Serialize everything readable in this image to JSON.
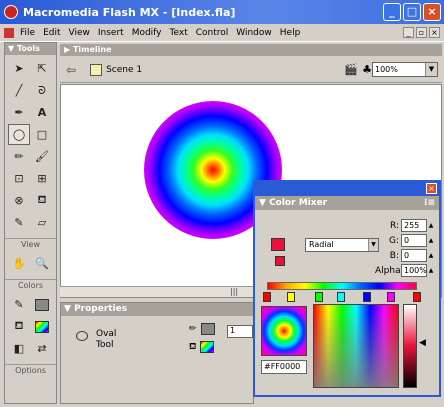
{
  "window": {
    "title": "Macromedia Flash MX - [Index.fla]"
  },
  "menu": [
    "File",
    "Edit",
    "View",
    "Insert",
    "Modify",
    "Text",
    "Control",
    "Window",
    "Help"
  ],
  "tools_panel": {
    "title": "Tools",
    "sections": {
      "view": "View",
      "colors": "Colors",
      "options": "Options"
    }
  },
  "timeline": {
    "title": "Timeline",
    "scene": "Scene 1",
    "zoom": "100%"
  },
  "properties": {
    "title": "Properties",
    "tool_line1": "Oval",
    "tool_line2": "Tool",
    "field": "1"
  },
  "color_mixer": {
    "title": "Color Mixer",
    "type": "Radial",
    "r_label": "R:",
    "g_label": "G:",
    "b_label": "B:",
    "alpha_label": "Alpha:",
    "r": "255",
    "g": "0",
    "b": "0",
    "alpha": "100%",
    "hex": "#FF0000",
    "pointer_colors": [
      "#ff0000",
      "#ffff00",
      "#00ff00",
      "#00ffff",
      "#0000ff",
      "#ff00ff",
      "#ff0000"
    ]
  },
  "colors": {
    "title_blue": "#2a5ad4",
    "panel_header": "#a6a29a",
    "fill": "#e8123a"
  }
}
